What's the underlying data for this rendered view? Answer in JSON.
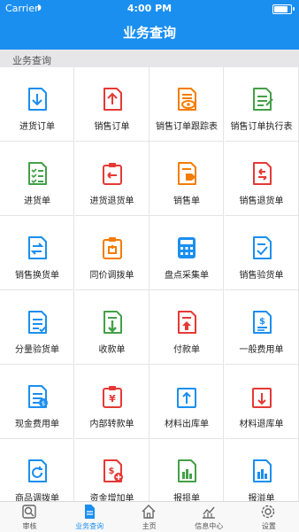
{
  "status_bar": {
    "carrier": "Carrier",
    "time": "4:00 PM"
  },
  "header": {
    "title": "业务查询"
  },
  "section": {
    "title": "业务查询"
  },
  "items": [
    {
      "label": "进货订单",
      "icon": "download-doc-icon",
      "color": "#1a8ff0"
    },
    {
      "label": "销售订单",
      "icon": "upload-doc-icon",
      "color": "#e53935"
    },
    {
      "label": "销售订单跟踪表",
      "icon": "tracking-eye-doc-icon",
      "color": "#f57c00"
    },
    {
      "label": "销售订单执行表",
      "icon": "edit-list-doc-icon",
      "color": "#43a047"
    },
    {
      "label": "进货单",
      "icon": "checklist-doc-icon",
      "color": "#43a047"
    },
    {
      "label": "进货退货单",
      "icon": "return-clipboard-icon",
      "color": "#e53935"
    },
    {
      "label": "销售单",
      "icon": "tag-doc-icon",
      "color": "#f57c00"
    },
    {
      "label": "销售退货单",
      "icon": "return-doc-icon",
      "color": "#e53935"
    },
    {
      "label": "销售换货单",
      "icon": "exchange-doc-icon",
      "color": "#1a8ff0"
    },
    {
      "label": "同价调拨单",
      "icon": "transfer-clipboard-icon",
      "color": "#f57c00"
    },
    {
      "label": "盘点采集单",
      "icon": "calculator-icon",
      "color": "#1a8ff0"
    },
    {
      "label": "销售验货单",
      "icon": "check-doc-icon",
      "color": "#1a8ff0"
    },
    {
      "label": "分量验货单",
      "icon": "partial-check-doc-icon",
      "color": "#1a8ff0"
    },
    {
      "label": "收款单",
      "icon": "receive-money-icon",
      "color": "#43a047"
    },
    {
      "label": "付款单",
      "icon": "pay-money-icon",
      "color": "#e53935"
    },
    {
      "label": "一般费用单",
      "icon": "dollar-doc-icon",
      "color": "#1a8ff0"
    },
    {
      "label": "现金费用单",
      "icon": "cash-doc-icon",
      "color": "#1a8ff0"
    },
    {
      "label": "内部转款单",
      "icon": "yen-transfer-icon",
      "color": "#e53935"
    },
    {
      "label": "材料出库单",
      "icon": "material-out-icon",
      "color": "#1a8ff0"
    },
    {
      "label": "材料退库单",
      "icon": "material-return-icon",
      "color": "#e53935"
    },
    {
      "label": "商品调拨单",
      "icon": "refresh-doc-icon",
      "color": "#1a8ff0"
    },
    {
      "label": "资金增加单",
      "icon": "fund-increase-icon",
      "color": "#e53935"
    },
    {
      "label": "报损单",
      "icon": "bar-chart-doc-icon",
      "color": "#43a047"
    },
    {
      "label": "报溢单",
      "icon": "bar-chart-doc-blue-icon",
      "color": "#1a8ff0"
    }
  ],
  "tabs": [
    {
      "label": "审核",
      "icon": "audit-icon",
      "active": false
    },
    {
      "label": "业务查询",
      "icon": "document-icon",
      "active": true
    },
    {
      "label": "主页",
      "icon": "home-icon",
      "active": false
    },
    {
      "label": "信息中心",
      "icon": "stats-icon",
      "active": false
    },
    {
      "label": "设置",
      "icon": "gear-icon",
      "active": false
    }
  ]
}
